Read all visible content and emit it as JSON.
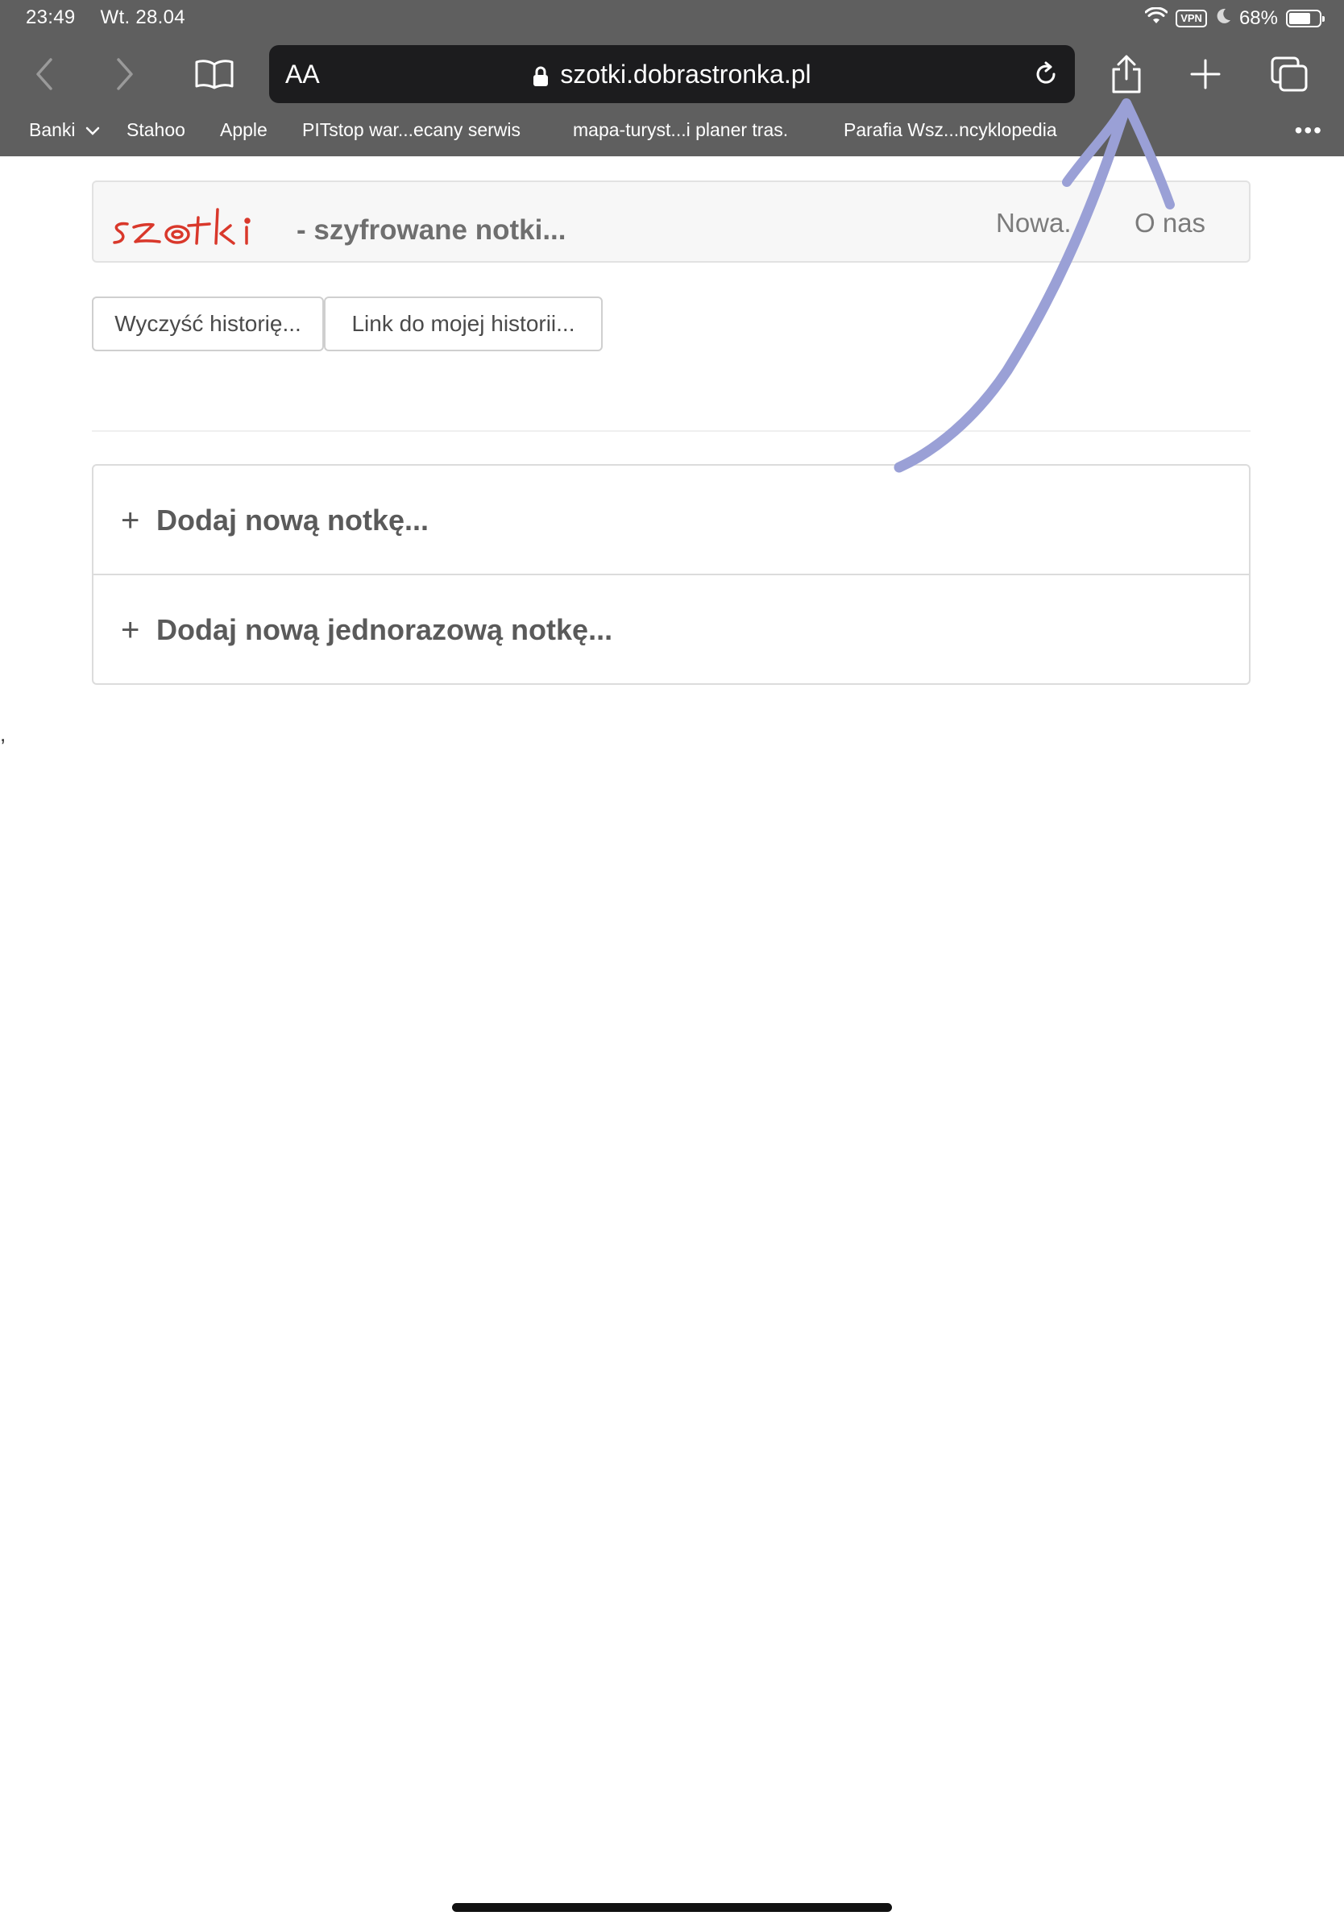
{
  "status_bar": {
    "time": "23:49",
    "date": "Wt. 28.04",
    "vpn": "VPN",
    "battery": "68%"
  },
  "toolbar": {
    "text_size_label": "AA",
    "url": "szotki.dobrastronka.pl"
  },
  "bookmarks": {
    "items": [
      {
        "label": "Banki"
      },
      {
        "label": "Stahoo"
      },
      {
        "label": "Apple"
      },
      {
        "label": "PITstop war...ecany serwis"
      },
      {
        "label": "mapa-turyst...i planer tras."
      },
      {
        "label": "Parafia Wsz...ncyklopedia"
      }
    ],
    "more": "•••"
  },
  "site": {
    "logo_text": "szotki",
    "tagline": "- szyfrowane notki...",
    "nav": [
      "Nowa.",
      "O nas"
    ],
    "buttons": {
      "clear_history": "Wyczyść historię...",
      "history_link": "Link do mojej historii..."
    },
    "notes": [
      {
        "plus": "+",
        "label": "Dodaj nową notkę..."
      },
      {
        "plus": "+",
        "label": "Dodaj nową jednorazową notkę..."
      }
    ],
    "stray_text": ","
  },
  "colors": {
    "chrome": "#5f5f5f",
    "address_bar": "#1c1c1e",
    "logo_red": "#d9382b",
    "annotation_arrow": "#9aa0d6"
  },
  "icons": [
    "back-icon",
    "forward-icon",
    "bookmarks-book-icon",
    "lock-icon",
    "reload-icon",
    "share-icon",
    "new-tab-plus-icon",
    "tabs-overview-icon",
    "wifi-icon",
    "moon-icon",
    "battery-icon",
    "chevron-down-icon"
  ]
}
